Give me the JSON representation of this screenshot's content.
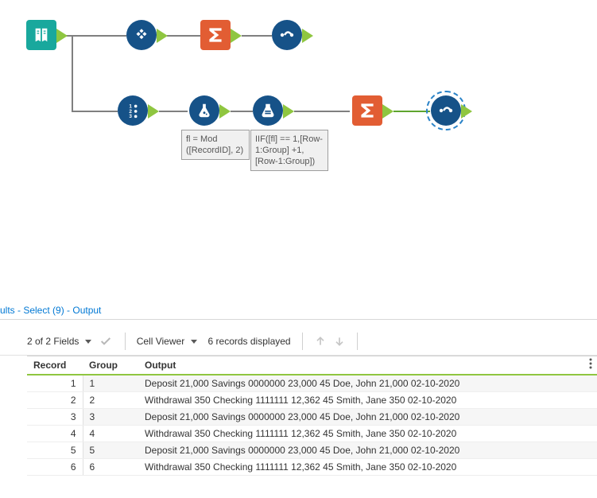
{
  "canvas": {
    "nodes": {
      "input": {
        "name": "input-tool"
      },
      "tile": {
        "name": "tile-tool"
      },
      "summarize1": {
        "name": "summarize-tool-1"
      },
      "browse1": {
        "name": "browse-tool-1"
      },
      "recordid": {
        "name": "recordid-tool"
      },
      "formula": {
        "name": "formula-tool",
        "annotation": "fl = Mod ([RecordID], 2)"
      },
      "multirow": {
        "name": "multirow-formula-tool",
        "annotation": "IIF([fl] == 1,[Row-1:Group] +1,[Row-1:Group])"
      },
      "summarize2": {
        "name": "summarize-tool-2"
      },
      "browse2": {
        "name": "browse-tool-2"
      }
    }
  },
  "results": {
    "tab_label": "ults - Select (9) - Output",
    "toolbar": {
      "fields_label": "2 of 2 Fields",
      "cell_viewer_label": "Cell Viewer",
      "records_label": "6 records displayed"
    },
    "columns": [
      "Record",
      "Group",
      "Output"
    ],
    "rows": [
      {
        "record": 1,
        "group": "1",
        "output": "Deposit 21,000 Savings 0000000 23,000 45 Doe, John 21,000 02-10-2020"
      },
      {
        "record": 2,
        "group": "2",
        "output": "Withdrawal 350 Checking 1111111 12,362 45 Smith, Jane 350 02-10-2020"
      },
      {
        "record": 3,
        "group": "3",
        "output": "Deposit 21,000 Savings 0000000 23,000 45 Doe, John 21,000 02-10-2020"
      },
      {
        "record": 4,
        "group": "4",
        "output": "Withdrawal 350 Checking 1111111 12,362 45 Smith, Jane 350 02-10-2020"
      },
      {
        "record": 5,
        "group": "5",
        "output": "Deposit 21,000 Savings 0000000 23,000 45 Doe, John 21,000 02-10-2020"
      },
      {
        "record": 6,
        "group": "6",
        "output": "Withdrawal 350 Checking 1111111 12,362 45 Smith, Jane 350 02-10-2020"
      }
    ]
  },
  "colors": {
    "node_blue": "#165288",
    "node_orange": "#e25d33",
    "node_teal": "#19a89d",
    "anchor_green": "#8fc640",
    "link": "#0078d4"
  }
}
